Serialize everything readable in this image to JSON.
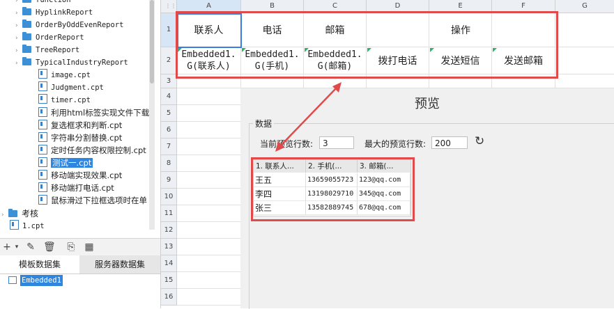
{
  "tree": {
    "items": [
      {
        "label": "function",
        "kind": "folder"
      },
      {
        "label": "HyplinkReport",
        "kind": "folder"
      },
      {
        "label": "OrderByOddEvenReport",
        "kind": "folder"
      },
      {
        "label": "OrderReport",
        "kind": "folder"
      },
      {
        "label": "TreeReport",
        "kind": "folder"
      },
      {
        "label": "TypicalIndustryReport",
        "kind": "folder"
      },
      {
        "label": "image.cpt",
        "kind": "file"
      },
      {
        "label": "Judgment.cpt",
        "kind": "file"
      },
      {
        "label": "timer.cpt",
        "kind": "file"
      },
      {
        "label": "利用html标签实现文件下载",
        "kind": "file"
      },
      {
        "label": "复选框求和判断.cpt",
        "kind": "file"
      },
      {
        "label": "字符串分割替换.cpt",
        "kind": "file"
      },
      {
        "label": "定时任务内容权限控制.cpt",
        "kind": "file"
      },
      {
        "label": "测试一.cpt",
        "kind": "file",
        "selected": true
      },
      {
        "label": "移动端实现效果.cpt",
        "kind": "file"
      },
      {
        "label": "移动端打电话.cpt",
        "kind": "file"
      },
      {
        "label": "鼠标滑过下拉框选项时在单",
        "kind": "file"
      }
    ],
    "root_folder": "考核",
    "root_file": "1.cpt"
  },
  "toolbar": {
    "icons": [
      "add-icon",
      "edit-icon",
      "delete-icon",
      "preview-icon",
      "dataset-icon"
    ]
  },
  "tabs": {
    "template": "模板数据集",
    "server": "服务器数据集"
  },
  "dataset": {
    "name": "Embedded1"
  },
  "sheet": {
    "columns": [
      "A",
      "B",
      "C",
      "D",
      "E",
      "F",
      "G"
    ],
    "rows": [
      "1",
      "2",
      "3",
      "4",
      "5",
      "6",
      "7",
      "8",
      "9",
      "10",
      "11",
      "12",
      "13",
      "14",
      "15",
      "16"
    ],
    "header_cells": {
      "contact": "联系人",
      "phone": "电话",
      "email": "邮箱",
      "action": "操作"
    },
    "data_cells": {
      "contact": "Embedded1.\nG(联系人)",
      "phone": "Embedded1.\nG(手机)",
      "email": "Embedded1.\nG(邮箱)",
      "call": "拨打电话",
      "sms": "发送短信",
      "mail": "发送邮箱"
    }
  },
  "preview": {
    "title": "预览",
    "group_label": "数据",
    "current_rows_label": "当前预览行数:",
    "current_rows_value": "3",
    "max_rows_label": "最大的预览行数:",
    "max_rows_value": "200",
    "grid_headers": [
      "1. 联系人...",
      "2. 手机(...",
      "3. 邮箱(..."
    ],
    "grid_rows": [
      [
        "王五",
        "13659055723",
        "123@qq.com"
      ],
      [
        "李四",
        "13198029710",
        "345@qq.com"
      ],
      [
        "张三",
        "13582889745",
        "678@qq.com"
      ]
    ]
  },
  "colors": {
    "accent": "#e04a4a",
    "selection": "#2e86de"
  }
}
